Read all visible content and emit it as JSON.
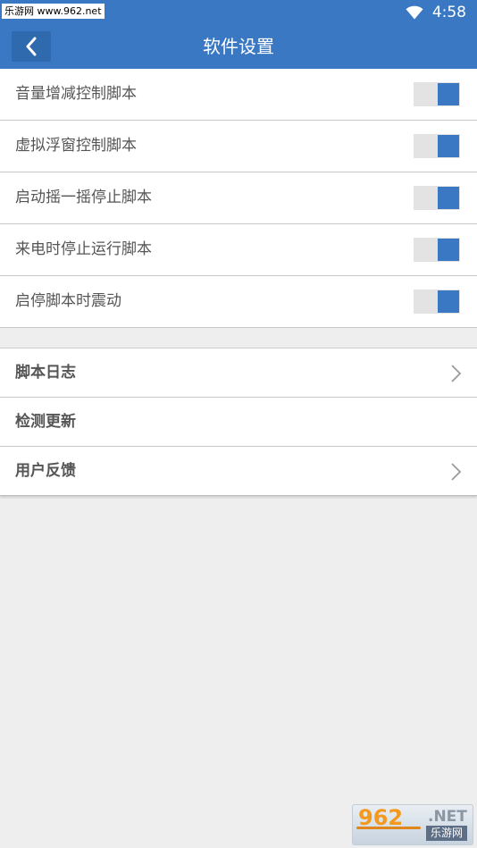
{
  "status_bar": {
    "watermark": "乐游网 www.962.net",
    "time": "4:58"
  },
  "app_bar": {
    "title": "软件设置"
  },
  "toggle_settings": [
    {
      "label": "音量增减控制脚本",
      "enabled": true
    },
    {
      "label": "虚拟浮窗控制脚本",
      "enabled": true
    },
    {
      "label": "启动摇一摇停止脚本",
      "enabled": true
    },
    {
      "label": "来电时停止运行脚本",
      "enabled": true
    },
    {
      "label": "启停脚本时震动",
      "enabled": true
    }
  ],
  "menu_items": [
    {
      "label": "脚本日志",
      "has_chevron": true
    },
    {
      "label": "检测更新",
      "has_chevron": false
    },
    {
      "label": "用户反馈",
      "has_chevron": true
    }
  ],
  "corner_watermark": {
    "big": "962",
    "net": ".NET",
    "small": "乐游网"
  },
  "colors": {
    "accent": "#3a78c3",
    "toggle_track": "#e3e3e3",
    "background": "#eeeeee"
  },
  "icons": {
    "back": "chevron-left-icon",
    "wifi": "wifi-icon",
    "row_arrow": "chevron-right-icon"
  }
}
